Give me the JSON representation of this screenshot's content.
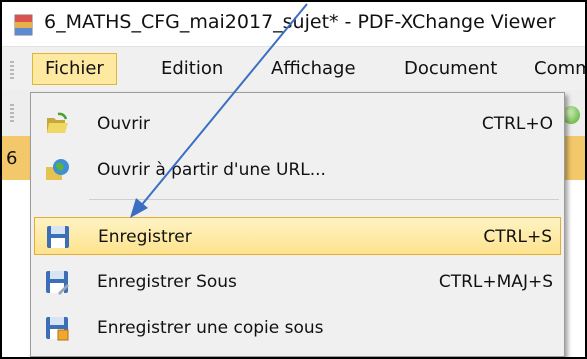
{
  "window": {
    "title": "6_MATHS_CFG_mai2017_sujet* - PDF-XChange Viewer",
    "app_icon": "pdf-xchange-app-icon"
  },
  "menubar": {
    "items": [
      {
        "label": "Fichier",
        "active": true
      },
      {
        "label": "Edition"
      },
      {
        "label": "Affichage"
      },
      {
        "label": "Document"
      },
      {
        "label": "Commentaires"
      }
    ]
  },
  "toolbar": {
    "icon": "green-ball-icon"
  },
  "tabstrip": {
    "tab_label": "6"
  },
  "file_menu": {
    "items": [
      {
        "label": "Ouvrir",
        "shortcut": "CTRL+O",
        "icon": "folder-open-icon"
      },
      {
        "label": "Ouvrir à partir d'une URL...",
        "shortcut": "",
        "icon": "globe-icon"
      },
      {
        "label": "Enregistrer",
        "shortcut": "CTRL+S",
        "icon": "floppy-disk-icon",
        "highlighted": true
      },
      {
        "label": "Enregistrer Sous",
        "shortcut": "CTRL+MAJ+S",
        "icon": "floppy-disk-save-as-icon"
      },
      {
        "label": "Enregistrer une copie sous",
        "shortcut": "",
        "icon": "floppy-disk-copy-icon"
      }
    ]
  },
  "colors": {
    "menu_highlight": "#fde38d",
    "menu_highlight_border": "#e3ad33",
    "annotation_arrow": "#3b6fc4",
    "tabstrip": "#f3c86b"
  }
}
